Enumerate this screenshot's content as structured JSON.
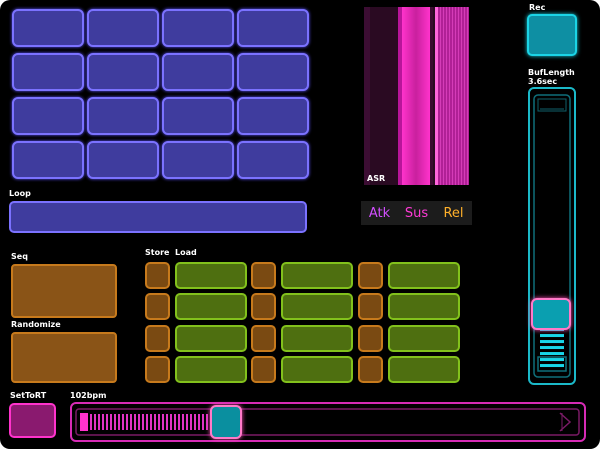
{
  "labels": {
    "loop": "Loop",
    "asr": "ASR",
    "seq": "Seq",
    "randomize": "Randomize",
    "store": "Store",
    "load": "Load",
    "rec": "Rec",
    "buflength": "BufLength",
    "buflength_value": "3.6sec",
    "settort": "SetToRT",
    "bpm": "102bpm"
  },
  "asr_tabs": [
    {
      "label": "Atk",
      "color": "#d24fff"
    },
    {
      "label": "Sus",
      "color": "#ff3ad6"
    },
    {
      "label": "Rel",
      "color": "#ffb02a"
    }
  ],
  "pad_grid": {
    "rows": 4,
    "cols": 4
  },
  "store_load_grid": {
    "rows": 4,
    "groups": 3
  },
  "buflength_level": 0.18,
  "bpm_level": 0.27,
  "colors": {
    "pad": "#3f3c9e",
    "accent_cyan": "#1bd4e6",
    "accent_magenta": "#ff33cc",
    "accent_orange": "#c77a1c",
    "accent_green": "#82c11c"
  }
}
